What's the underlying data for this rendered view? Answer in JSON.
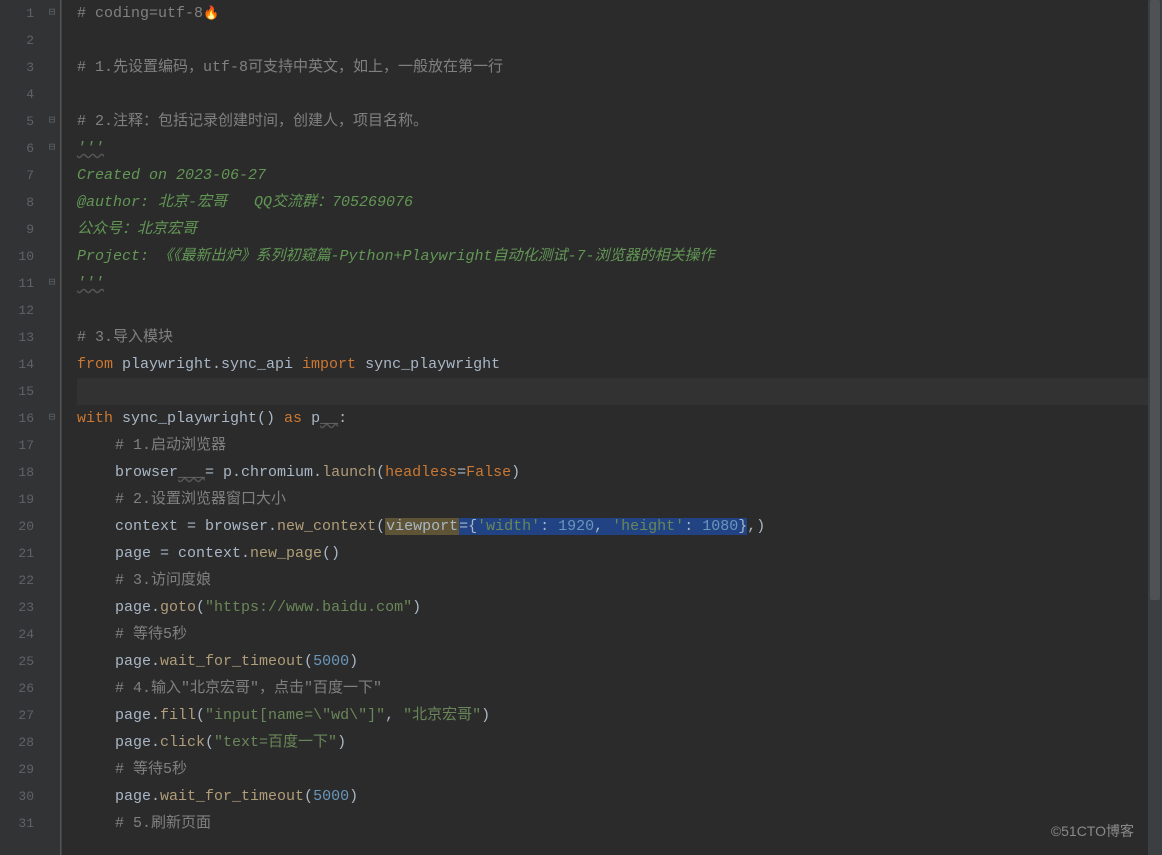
{
  "gutter": {
    "start": 1,
    "end": 31
  },
  "fold_markers": {
    "1": "⊟",
    "5": "⊟",
    "6": "⊟",
    "11": "⊟",
    "16": "⊟"
  },
  "code": {
    "l1": {
      "comment": "# coding=utf-8",
      "icon": "🔥"
    },
    "l3": {
      "comment": "# 1.先设置编码，utf-8可支持中英文，如上，一般放在第一行"
    },
    "l5": {
      "comment": "# 2.注释：包括记录创建时间，创建人，项目名称。"
    },
    "l6": {
      "doc": "'''"
    },
    "l7": {
      "doc": "Created on 2023-06-27"
    },
    "l8": {
      "doc": "@author: 北京-宏哥   QQ交流群：705269076"
    },
    "l9": {
      "doc": "公众号：北京宏哥"
    },
    "l10": {
      "doc": "Project: 《《最新出炉》系列初窥篇-Python+Playwright自动化测试-7-浏览器的相关操作"
    },
    "l11": {
      "doc": "'''"
    },
    "l13": {
      "comment": "# 3.导入模块"
    },
    "l14": {
      "from": "from",
      "mod": " playwright.sync_api ",
      "import": "import",
      "name": " sync_playwright"
    },
    "l16": {
      "with": "with",
      "call": " sync_playwright() ",
      "as": "as",
      "p": " p",
      "weak": "__",
      "colon": ":"
    },
    "l17": {
      "comment": "# 1.启动浏览器"
    },
    "l18": {
      "a": "browser",
      "weak": "___",
      "eq": "= p.chromium.",
      "fn": "launch",
      "open": "(",
      "kw": "headless",
      "assign": "=",
      "val": "False",
      "close": ")"
    },
    "l19": {
      "comment": "# 2.设置浏览器窗口大小"
    },
    "l20": {
      "a": "context = browser.",
      "fn": "new_context",
      "open": "(",
      "kw": "viewport",
      "assign": "={",
      "k1": "'width'",
      "sep1": ": ",
      "v1": "1920",
      "comma": ", ",
      "k2": "'height'",
      "sep2": ": ",
      "v2": "1080",
      "close": "},)"
    },
    "l21": {
      "a": "page = context.",
      "fn": "new_page",
      "p": "()"
    },
    "l22": {
      "comment": "# 3.访问度娘"
    },
    "l23": {
      "a": "page.",
      "fn": "goto",
      "open": "(",
      "str": "\"https://www.baidu.com\"",
      "close": ")"
    },
    "l24": {
      "comment": "# 等待5秒"
    },
    "l25": {
      "a": "page.",
      "fn": "wait_for_timeout",
      "open": "(",
      "num": "5000",
      "close": ")"
    },
    "l26": {
      "comment": "# 4.输入\"北京宏哥\"，点击\"百度一下\""
    },
    "l27": {
      "a": "page.",
      "fn": "fill",
      "open": "(",
      "s1": "\"input[name=\\\"wd\\\"]\"",
      "comma": ", ",
      "s2": "\"北京宏哥\"",
      "close": ")"
    },
    "l28": {
      "a": "page.",
      "fn": "click",
      "open": "(",
      "str": "\"text=百度一下\"",
      "close": ")"
    },
    "l29": {
      "comment": "# 等待5秒"
    },
    "l30": {
      "a": "page.",
      "fn": "wait_for_timeout",
      "open": "(",
      "num": "5000",
      "close": ")"
    },
    "l31": {
      "comment": "# 5.刷新页面"
    }
  },
  "watermark": "©51CTO博客"
}
